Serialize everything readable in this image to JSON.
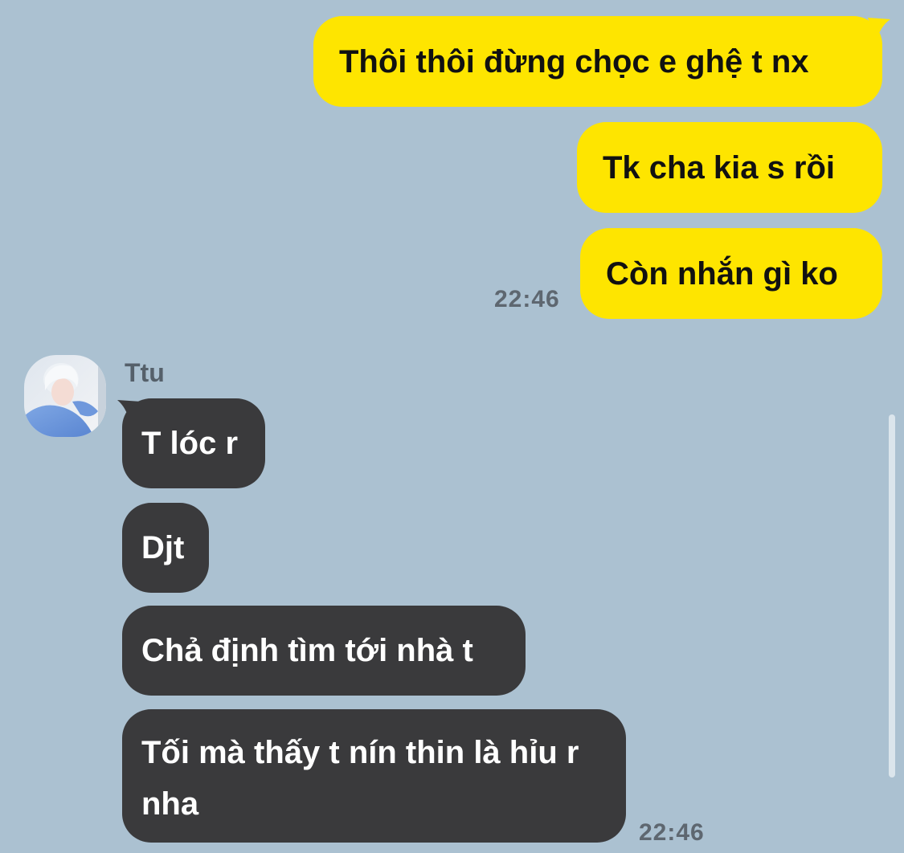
{
  "conversation": {
    "outgoing": [
      {
        "text": "Thôi thôi đừng chọc e ghệ t nx"
      },
      {
        "text": "Tk cha kia s rồi"
      },
      {
        "text": "Còn nhắn gì ko"
      }
    ],
    "outgoing_time": "22:46",
    "incoming": {
      "sender": "Ttu",
      "avatar": "avatar-photo",
      "messages": [
        {
          "text": "T lóc r"
        },
        {
          "text": "Djt"
        },
        {
          "text": "Chả định tìm tới nhà t"
        },
        {
          "text": "Tối mà thấy t nín thin là hỉu r nha"
        }
      ],
      "time": "22:46"
    }
  },
  "colors": {
    "background": "#abc1d1",
    "outgoing_bubble": "#fee500",
    "incoming_bubble": "#3a3a3c"
  }
}
